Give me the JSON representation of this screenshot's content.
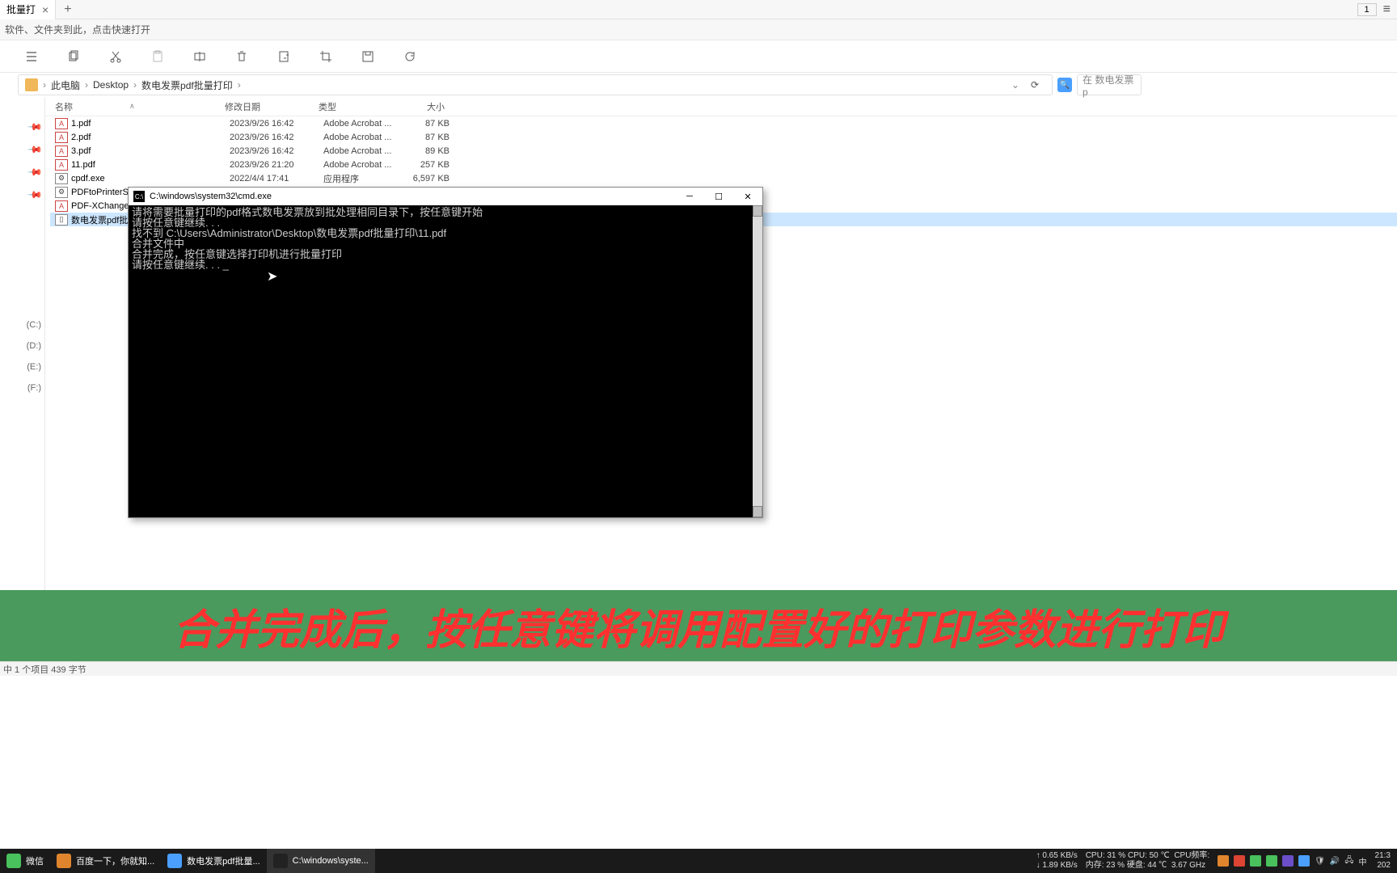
{
  "tab": {
    "title": "批量打",
    "badge": "1"
  },
  "hint": "软件、文件夹到此，点击快速打开",
  "breadcrumb": [
    "此电脑",
    "Desktop",
    "数电发票pdf批量打印"
  ],
  "search_placeholder": "在 数电发票p",
  "columns": {
    "name": "名称",
    "date": "修改日期",
    "type": "类型",
    "size": "大小"
  },
  "files": [
    {
      "icon": "pdf",
      "name": "1.pdf",
      "date": "2023/9/26 16:42",
      "type": "Adobe Acrobat ...",
      "size": "87 KB",
      "selected": false
    },
    {
      "icon": "pdf",
      "name": "2.pdf",
      "date": "2023/9/26 16:42",
      "type": "Adobe Acrobat ...",
      "size": "87 KB",
      "selected": false
    },
    {
      "icon": "pdf",
      "name": "3.pdf",
      "date": "2023/9/26 16:42",
      "type": "Adobe Acrobat ...",
      "size": "89 KB",
      "selected": false
    },
    {
      "icon": "pdf",
      "name": "11.pdf",
      "date": "2023/9/26 21:20",
      "type": "Adobe Acrobat ...",
      "size": "257 KB",
      "selected": false
    },
    {
      "icon": "exe",
      "name": "cpdf.exe",
      "date": "2022/4/4 17:41",
      "type": "应用程序",
      "size": "6,597 KB",
      "selected": false
    },
    {
      "icon": "exe",
      "name": "PDFtoPrinterSele",
      "date": "",
      "type": "",
      "size": "",
      "selected": false
    },
    {
      "icon": "pdf",
      "name": "PDF-XChange Vi",
      "date": "",
      "type": "",
      "size": "",
      "selected": false
    },
    {
      "icon": "bat",
      "name": "数电发票pdf批量",
      "date": "",
      "type": "",
      "size": "",
      "selected": true
    }
  ],
  "drives": [
    "(C:)",
    "(D:)",
    "(E:)",
    "(F:)"
  ],
  "cmd": {
    "title": "C:\\windows\\system32\\cmd.exe",
    "lines": [
      "请将需要批量打印的pdf格式数电发票放到批处理相同目录下，按任意键开始",
      "请按任意键继续. . .",
      "找不到 C:\\Users\\Administrator\\Desktop\\数电发票pdf批量打印\\11.pdf",
      "合并文件中",
      "合并完成，按任意键选择打印机进行批量打印",
      "请按任意键继续. . . _"
    ]
  },
  "banner": "合并完成后，按任意键将调用配置好的打印参数进行打印",
  "status": "中 1 个项目  439 字节",
  "taskbar": {
    "items": [
      {
        "label": "微信",
        "color": "#49c15c"
      },
      {
        "label": "百度一下，你就知...",
        "color": "#e0852e"
      },
      {
        "label": "数电发票pdf批量...",
        "color": "#4a9fff"
      },
      {
        "label": "C:\\windows\\syste...",
        "color": "#222"
      }
    ],
    "net_up": "↑ 0.65 KB/s",
    "net_down": "↓ 1.89 KB/s",
    "cpu": "CPU: 31 % CPU: 50 ℃",
    "cpu_freq": "CPU频率:",
    "mem": "内存: 23 % 硬盘: 44 ℃",
    "freq": "3.67 GHz",
    "time": "21:3",
    "date": "202",
    "ime": "中"
  }
}
